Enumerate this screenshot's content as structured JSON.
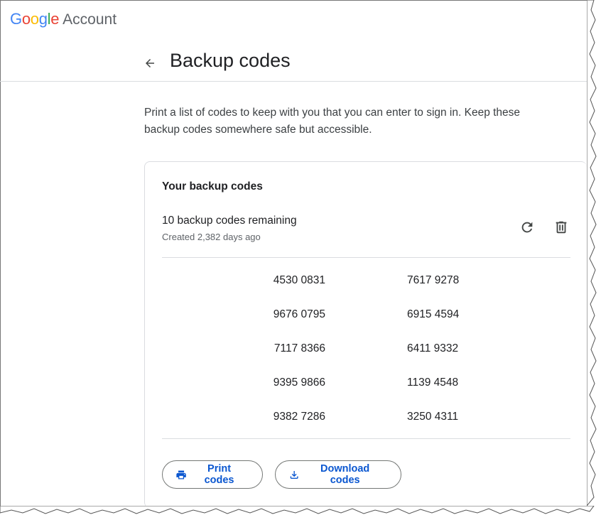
{
  "brand": {
    "google_letters": [
      {
        "ch": "G",
        "color": "#4285F4"
      },
      {
        "ch": "o",
        "color": "#EA4335"
      },
      {
        "ch": "o",
        "color": "#FBBC05"
      },
      {
        "ch": "g",
        "color": "#4285F4"
      },
      {
        "ch": "l",
        "color": "#34A853"
      },
      {
        "ch": "e",
        "color": "#EA4335"
      }
    ],
    "suffix": "Account"
  },
  "header": {
    "back_icon": "arrow-left-icon",
    "title": "Backup codes"
  },
  "description": "Print a list of codes to keep with you that you can enter to sign in. Keep these backup codes somewhere safe but accessible.",
  "card": {
    "title": "Your backup codes",
    "remaining": "10 backup codes remaining",
    "created": "Created 2,382 days ago",
    "actions": {
      "refresh_icon": "refresh-icon",
      "delete_icon": "trash-icon"
    },
    "codes": [
      [
        "4530 0831",
        "7617 9278"
      ],
      [
        "9676 0795",
        "6915 4594"
      ],
      [
        "7117 8366",
        "6411 9332"
      ],
      [
        "9395 9866",
        "1139 4548"
      ],
      [
        "9382 7286",
        "3250 4311"
      ]
    ],
    "buttons": {
      "print_label": "Print codes",
      "download_label": "Download codes"
    }
  },
  "colors": {
    "accent": "#0b57d0",
    "divider": "#dadce0",
    "text_primary": "#202124",
    "text_secondary": "#5f6368"
  }
}
